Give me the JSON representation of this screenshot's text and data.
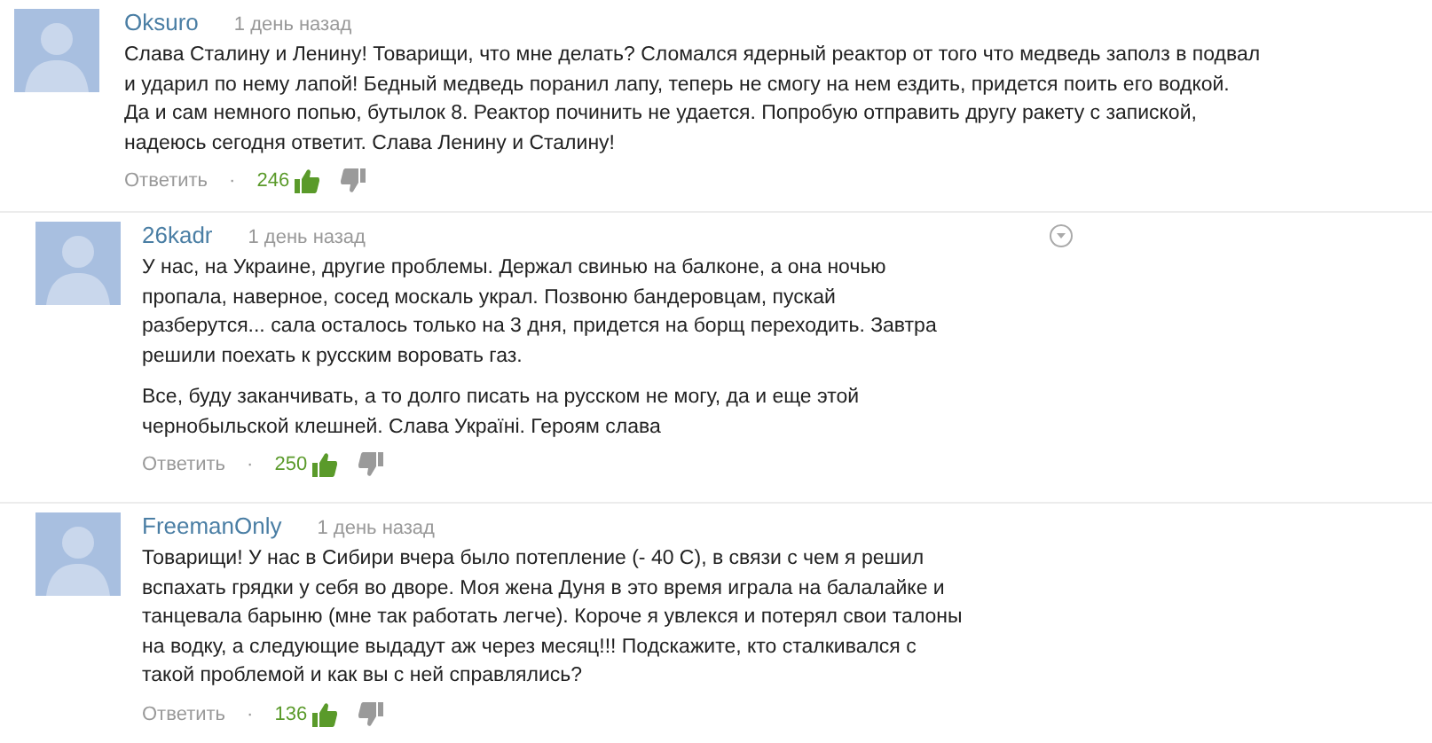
{
  "comments": [
    {
      "kind": "top",
      "author": "Oksuro",
      "time": "1 день назад",
      "menu_icon": false,
      "paragraphs": [
        "Слава Сталину и Ленину! Товарищи, что мне делать? Сломался ядерный реактор от того что медведь заполз в подвал\nи ударил по нему лапой! Бедный медведь поранил лапу, теперь не смогу на нем ездить, придется поить его водкой.\nДа и сам немного попью, бутылок 8. Реактор починить не удается. Попробую отправить другу ракету с запиской,\nнадеюсь сегодня ответит. Слава Ленину и Сталину!"
      ],
      "reply": "Ответить",
      "separator": "·",
      "likes": "246"
    },
    {
      "kind": "reply",
      "author": "26kadr",
      "time": "1 день назад",
      "menu_icon": true,
      "paragraphs": [
        "У нас, на Украине, другие проблемы. Держал свинью на балконе, а она ночью\nпропала, наверное, сосед москаль украл. Позвоню бандеровцам, пускай\nразберутся... сала осталось только на 3 дня, придется на борщ переходить. Завтра\nрешили поехать к русским воровать газ.",
        "Все, буду заканчивать, а то долго писать на русском не могу, да и еще этой\nчернобыльской клешней. Слава Україні. Героям слава"
      ],
      "reply": "Ответить",
      "separator": "·",
      "likes": "250"
    },
    {
      "kind": "reply",
      "author": "FreemanOnly",
      "time": "1 день назад",
      "menu_icon": false,
      "paragraphs": [
        "Товарищи! У нас в Сибири вчера было потепление (- 40 С), в связи с чем я решил\nвспахать грядки у себя во дворе. Моя жена Дуня в это время играла на балалайке и\nтанцевала барыню (мне так работать легче). Короче я увлекся и потерял свои талоны\nна водку, а следующие выдадут аж через месяц!!! Подскажите, кто сталкивался с\nтакой проблемой и как вы с ней справлялись?"
      ],
      "reply": "Ответить",
      "separator": "·",
      "likes": "136"
    }
  ]
}
